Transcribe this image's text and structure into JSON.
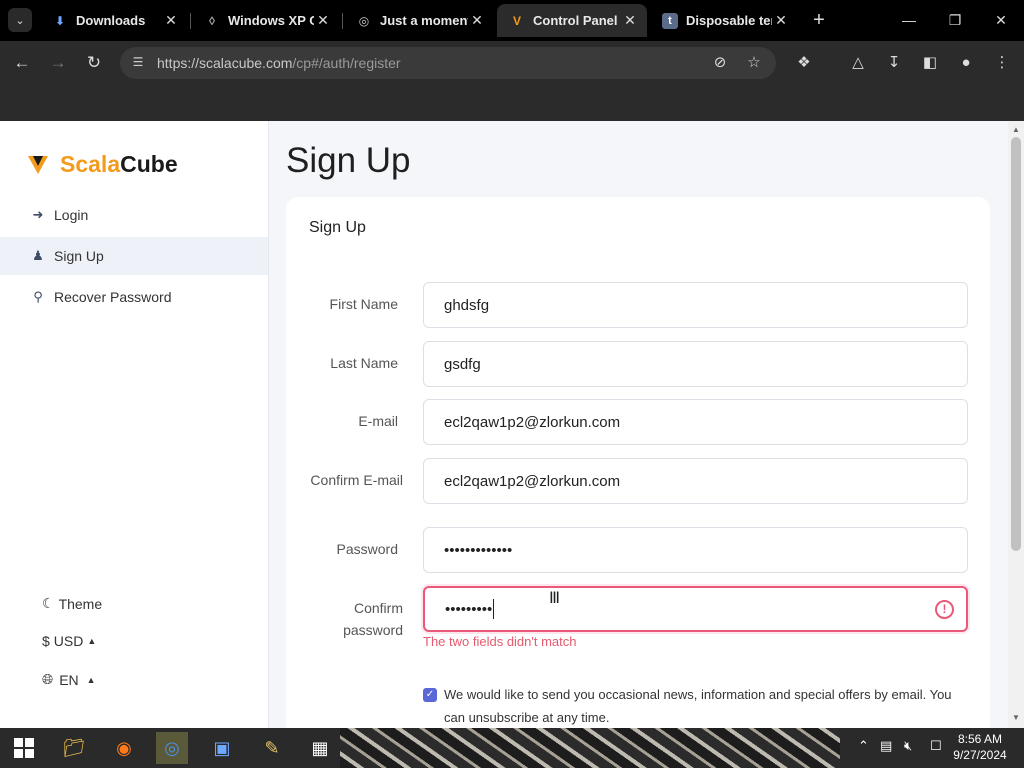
{
  "browser": {
    "tabs": [
      {
        "title": "Downloads",
        "icon": "download-icon",
        "active": false
      },
      {
        "title": "Windows XP O",
        "icon": "xp-icon",
        "active": false
      },
      {
        "title": "Just a moment",
        "icon": "globe-icon",
        "active": false
      },
      {
        "title": "Control Panel -",
        "icon": "scalacube-icon",
        "active": true
      },
      {
        "title": "Disposable ter",
        "icon": "t-icon",
        "active": false
      }
    ],
    "url_host": "https://scalacube.com",
    "url_path": "/cp#/auth/register"
  },
  "sidebar": {
    "brand_part1": "Scala",
    "brand_part2": "Cube",
    "items": [
      {
        "label": "Login",
        "icon": "login-icon"
      },
      {
        "label": "Sign Up",
        "icon": "user-plus-icon",
        "active": true
      },
      {
        "label": "Recover Password",
        "icon": "key-icon"
      }
    ],
    "theme_label": "Theme",
    "currency_label": "USD",
    "language_label": "EN"
  },
  "main": {
    "heading": "Sign Up",
    "card_title": "Sign Up",
    "fields": {
      "first_name": {
        "label": "First Name",
        "value": "ghdsfg"
      },
      "last_name": {
        "label": "Last Name",
        "value": "gsdfg"
      },
      "email": {
        "label": "E-mail",
        "value": "ecl2qaw1p2@zlorkun.com"
      },
      "confirm_email": {
        "label": "Confirm E-mail",
        "value": "ecl2qaw1p2@zlorkun.com"
      },
      "password": {
        "label": "Password",
        "value": "•••••••••••••"
      },
      "confirm_password": {
        "label": "Confirm password",
        "value": "•••••••••"
      }
    },
    "error_message": "The two fields didn't match",
    "newsletter_text": "We would like to send you occasional news, information and special offers by email. You can unsubscribe at any time.",
    "newsletter_checked": true
  },
  "taskbar": {
    "time": "8:56 AM",
    "date": "9/27/2024"
  },
  "colors": {
    "accent": "#f29b1d",
    "error": "#e8597a",
    "checkbox": "#5a67d8"
  }
}
